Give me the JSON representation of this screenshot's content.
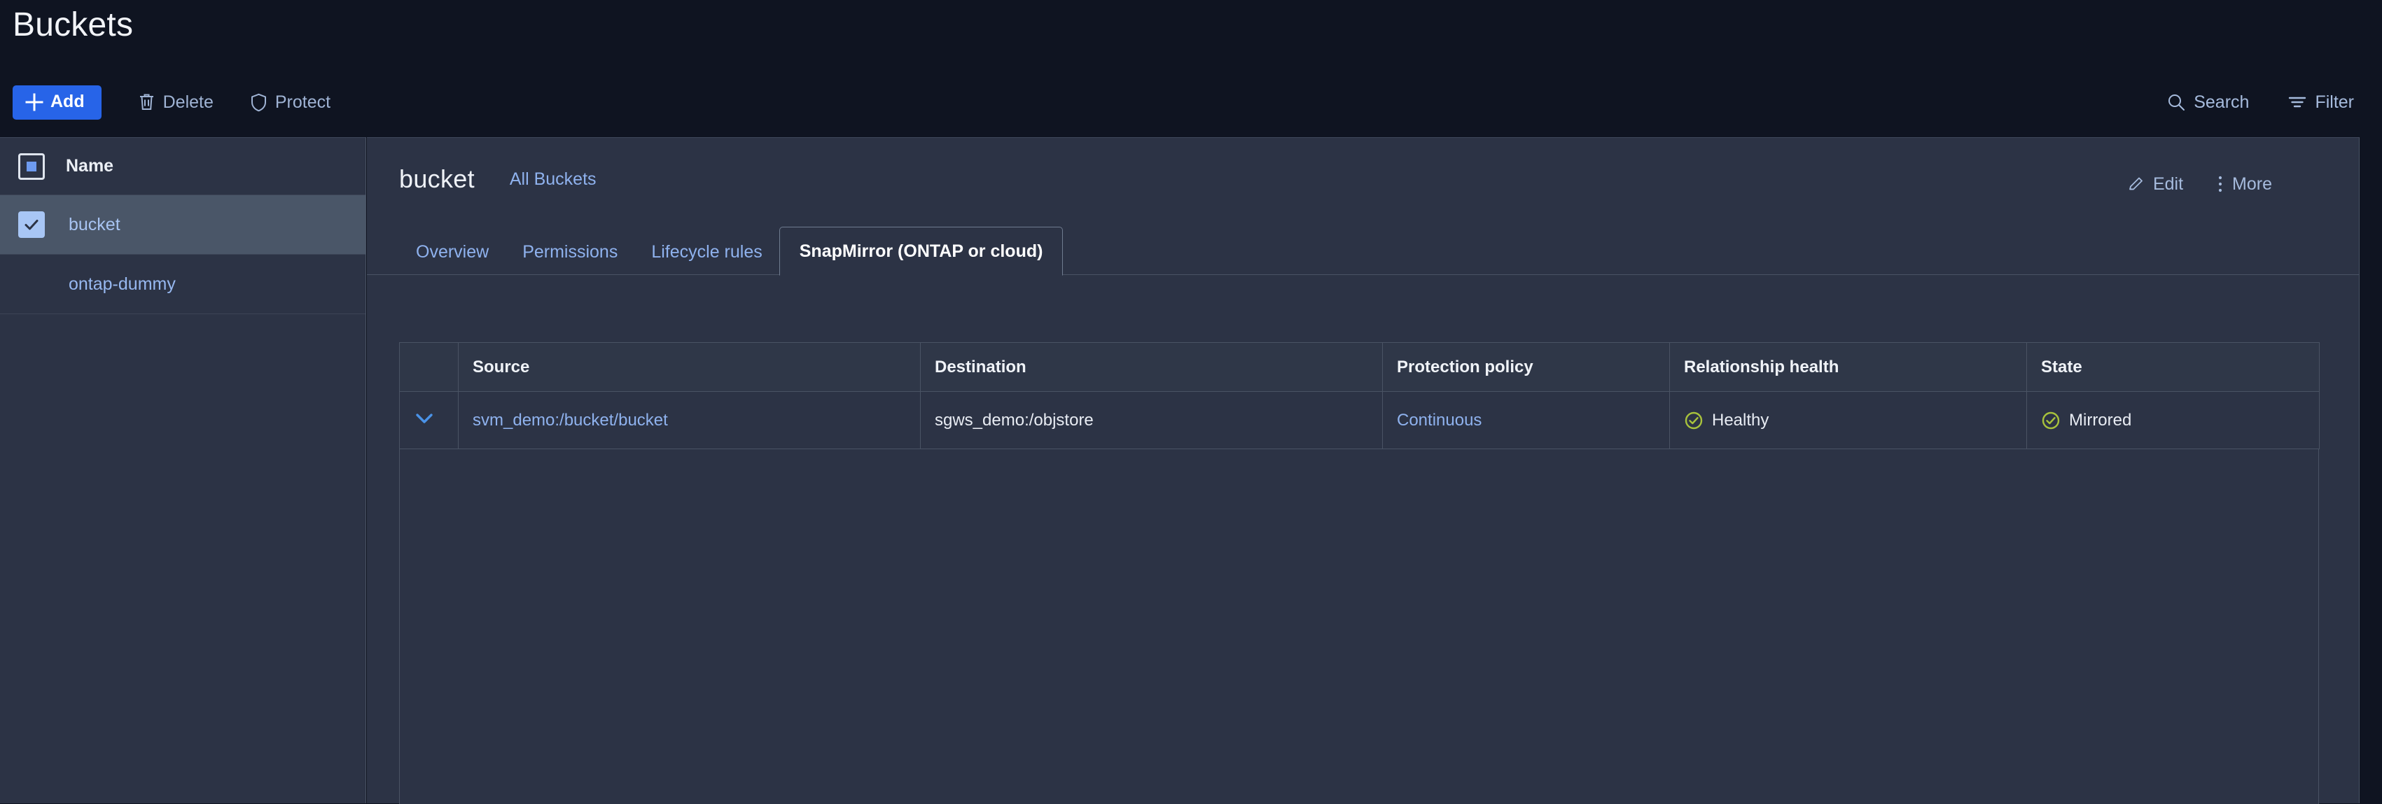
{
  "page": {
    "title": "Buckets"
  },
  "toolbar": {
    "add_label": "Add",
    "delete_label": "Delete",
    "protect_label": "Protect",
    "search_label": "Search",
    "filter_label": "Filter",
    "icons": {
      "add": "plus-icon",
      "delete": "trash-icon",
      "protect": "shield-icon",
      "search": "search-icon",
      "filter": "filter-icon"
    },
    "accent_color": "#2764e8"
  },
  "sidebar": {
    "header": {
      "checkbox_state": "indeterminate",
      "name_label": "Name"
    },
    "items": [
      {
        "label": "bucket",
        "checked": true,
        "selected": true
      },
      {
        "label": "ontap-dummy",
        "checked": false,
        "selected": false
      }
    ]
  },
  "panel": {
    "title": "bucket",
    "breadcrumb": "All Buckets",
    "actions": {
      "edit_label": "Edit",
      "more_label": "More",
      "edit_icon": "pencil-icon",
      "more_icon": "kebab-menu-icon"
    },
    "tabs": [
      {
        "label": "Overview",
        "active": false
      },
      {
        "label": "Permissions",
        "active": false
      },
      {
        "label": "Lifecycle rules",
        "active": false
      },
      {
        "label": "SnapMirror (ONTAP or cloud)",
        "active": true
      }
    ]
  },
  "table": {
    "columns": [
      {
        "key": "expander",
        "label": ""
      },
      {
        "key": "source",
        "label": "Source"
      },
      {
        "key": "destination",
        "label": "Destination"
      },
      {
        "key": "policy",
        "label": "Protection policy"
      },
      {
        "key": "health",
        "label": "Relationship health"
      },
      {
        "key": "state",
        "label": "State"
      }
    ],
    "rows": [
      {
        "expander_icon": "chevron-down-icon",
        "source": "svm_demo:/bucket/bucket",
        "destination": "sgws_demo:/objstore",
        "policy": "Continuous",
        "health": "Healthy",
        "health_icon": "check-circle-icon",
        "state": "Mirrored",
        "state_icon": "check-circle-icon"
      }
    ],
    "status_color": "#a8c23c",
    "link_color": "#8fb2ee"
  }
}
